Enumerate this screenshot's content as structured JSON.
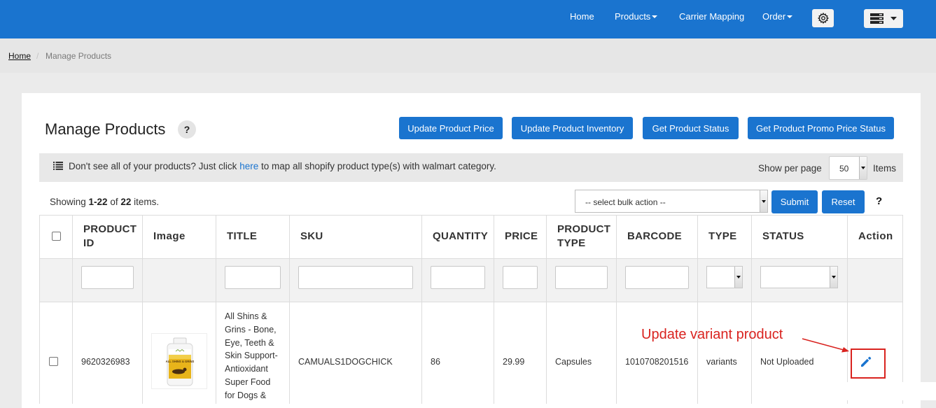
{
  "nav": {
    "items": [
      {
        "label": "Home",
        "dropdown": false
      },
      {
        "label": "Products",
        "dropdown": true
      },
      {
        "label": "Carrier Mapping",
        "dropdown": false
      },
      {
        "label": "Order",
        "dropdown": true
      }
    ],
    "settings_icon": "gear-icon",
    "menu_icon": "server-stack-icon"
  },
  "breadcrumb": {
    "home": "Home",
    "separator": "/",
    "current": "Manage Products"
  },
  "page": {
    "title": "Manage Products",
    "help": "?",
    "buttons": [
      "Update Product Price",
      "Update Product Inventory",
      "Get Product Status",
      "Get Product Promo Price Status"
    ]
  },
  "info": {
    "icon": "list-icon",
    "text_before": "Don't see all of your products? Just click ",
    "link": "here",
    "text_after": " to map all shopify product type(s) with walmart category.",
    "show_per_page_label": "Show per page",
    "per_page_value": "50",
    "items_label": "Items"
  },
  "summary": {
    "prefix": "Showing ",
    "range": "1-22",
    "middle": " of ",
    "total": "22",
    "suffix": " items."
  },
  "bulk": {
    "placeholder": "-- select bulk action --",
    "submit": "Submit",
    "reset": "Reset",
    "help": "?"
  },
  "table": {
    "headers": {
      "product_id_1": "PRODUCT",
      "product_id_2": "ID",
      "image": "Image",
      "title": "TITLE",
      "sku": "SKU",
      "quantity": "QUANTITY",
      "price": "PRICE",
      "product_type_1": "PRODUCT",
      "product_type_2": "TYPE",
      "barcode": "BARCODE",
      "type": "TYPE",
      "status": "STATUS",
      "action": "Action"
    },
    "rows": [
      {
        "product_id": "9620326983",
        "title": "All Shins & Grins - Bone, Eye, Teeth & Skin Support- Antioxidant Super Food for Dogs &",
        "sku": "CAMUALS1DOGCHICK",
        "quantity": "86",
        "price": "29.99",
        "product_type": "Capsules",
        "barcode": "1010708201516",
        "type": "variants",
        "status": "Not Uploaded",
        "image_label": "ALL SHINS & GRINS"
      }
    ]
  },
  "annotation": {
    "text": "Update variant product",
    "color": "#d9231f"
  },
  "colors": {
    "primary": "#1a74cf",
    "navbar": "#1a74cf"
  }
}
